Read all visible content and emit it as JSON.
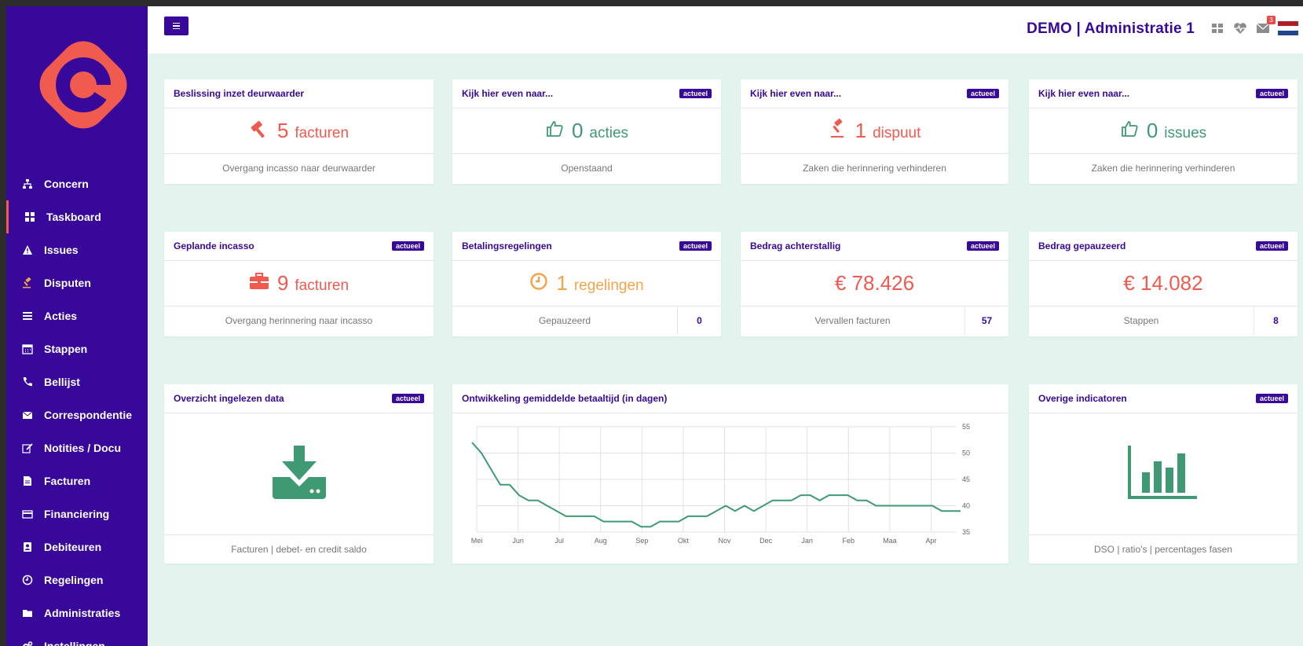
{
  "app": {
    "header_title": "DEMO | Administratie 1",
    "mail_badge": "3",
    "menu_button_label": "≡"
  },
  "colors": {
    "primary": "#37089a",
    "accent": "#f05a4f",
    "green": "#3f9a74",
    "orange": "#f7a34a",
    "background": "#e3f4ee"
  },
  "sidebar": {
    "items": [
      {
        "label": "Concern",
        "icon": "sitemap-icon"
      },
      {
        "label": "Taskboard",
        "icon": "dashboard-grid-icon",
        "active": true
      },
      {
        "label": "Issues",
        "icon": "warning-icon"
      },
      {
        "label": "Disputen",
        "icon": "gavel-icon"
      },
      {
        "label": "Acties",
        "icon": "list-icon"
      },
      {
        "label": "Stappen",
        "icon": "calendar-icon"
      },
      {
        "label": "Bellijst",
        "icon": "phone-icon"
      },
      {
        "label": "Correspondentie",
        "icon": "envelope-icon"
      },
      {
        "label": "Notities / Docu",
        "icon": "edit-icon"
      },
      {
        "label": "Facturen",
        "icon": "file-icon"
      },
      {
        "label": "Financiering",
        "icon": "credit-card-icon"
      },
      {
        "label": "Debiteuren",
        "icon": "contact-icon"
      },
      {
        "label": "Regelingen",
        "icon": "clock-icon"
      },
      {
        "label": "Administraties",
        "icon": "folder-icon"
      },
      {
        "label": "Instellingen",
        "icon": "cogs-icon"
      }
    ]
  },
  "cards": {
    "c1": {
      "title": "Beslissing inzet deurwaarder",
      "number": "5",
      "unit": "facturen",
      "footer": "Overgang incasso naar deurwaarder",
      "icon": "gavel-icon"
    },
    "c2": {
      "title": "Kijk hier even naar...",
      "badge": "actueel",
      "number": "0",
      "unit": "acties",
      "footer": "Openstaand",
      "icon": "thumbs-up-icon"
    },
    "c3": {
      "title": "Kijk hier even naar...",
      "badge": "actueel",
      "number": "1",
      "unit": "dispuut",
      "footer": "Zaken die herinnering verhinderen",
      "icon": "gavel-icon"
    },
    "c4": {
      "title": "Kijk hier even naar...",
      "badge": "actueel",
      "number": "0",
      "unit": "issues",
      "footer": "Zaken die herinnering verhinderen",
      "icon": "thumbs-up-icon"
    },
    "c5": {
      "title": "Geplande incasso",
      "badge": "actueel",
      "number": "9",
      "unit": "facturen",
      "footer": "Overgang herinnering naar incasso",
      "icon": "briefcase-icon"
    },
    "c6": {
      "title": "Betalingsregelingen",
      "badge": "actueel",
      "number": "1",
      "unit": "regelingen",
      "footer": "Gepauzeerd",
      "count": "0",
      "icon": "clock-icon"
    },
    "c7": {
      "title": "Bedrag achterstallig",
      "badge": "actueel",
      "amount": "€ 78.426",
      "footer": "Vervallen facturen",
      "count": "57"
    },
    "c8": {
      "title": "Bedrag gepauzeerd",
      "badge": "actueel",
      "amount": "€ 14.082",
      "footer": "Stappen",
      "count": "8"
    },
    "c9": {
      "title": "Overzicht ingelezen data",
      "badge": "actueel",
      "footer": "Facturen | debet- en credit saldo",
      "icon": "download-icon"
    },
    "c10": {
      "title": "Ontwikkeling gemiddelde betaaltijd (in dagen)"
    },
    "c11": {
      "title": "Overige indicatoren",
      "badge": "actueel",
      "footer": "DSO | ratio's | percentages fasen",
      "icon": "bar-chart-icon"
    }
  },
  "chart_data": {
    "type": "line",
    "title": "Ontwikkeling gemiddelde betaaltijd (in dagen)",
    "categories": [
      "Mei",
      "Jun",
      "Jul",
      "Aug",
      "Sep",
      "Okt",
      "Nov",
      "Dec",
      "Jan",
      "Feb",
      "Maa",
      "Apr"
    ],
    "y_ticks": [
      35,
      40,
      45,
      50,
      55
    ],
    "ylim": [
      35,
      55
    ],
    "grid": true,
    "series": [
      {
        "values": [
          52,
          50,
          47,
          44,
          44,
          42,
          41,
          41,
          40,
          39,
          38,
          38,
          38,
          38,
          37,
          37,
          37,
          37,
          36,
          36,
          37,
          37,
          37,
          38,
          38,
          38,
          39,
          40,
          39,
          40,
          39,
          40,
          41,
          41,
          41,
          42,
          42,
          41,
          42,
          42,
          42,
          41,
          41,
          40,
          40,
          40,
          40,
          40,
          40,
          40,
          39,
          39,
          39
        ]
      }
    ]
  }
}
